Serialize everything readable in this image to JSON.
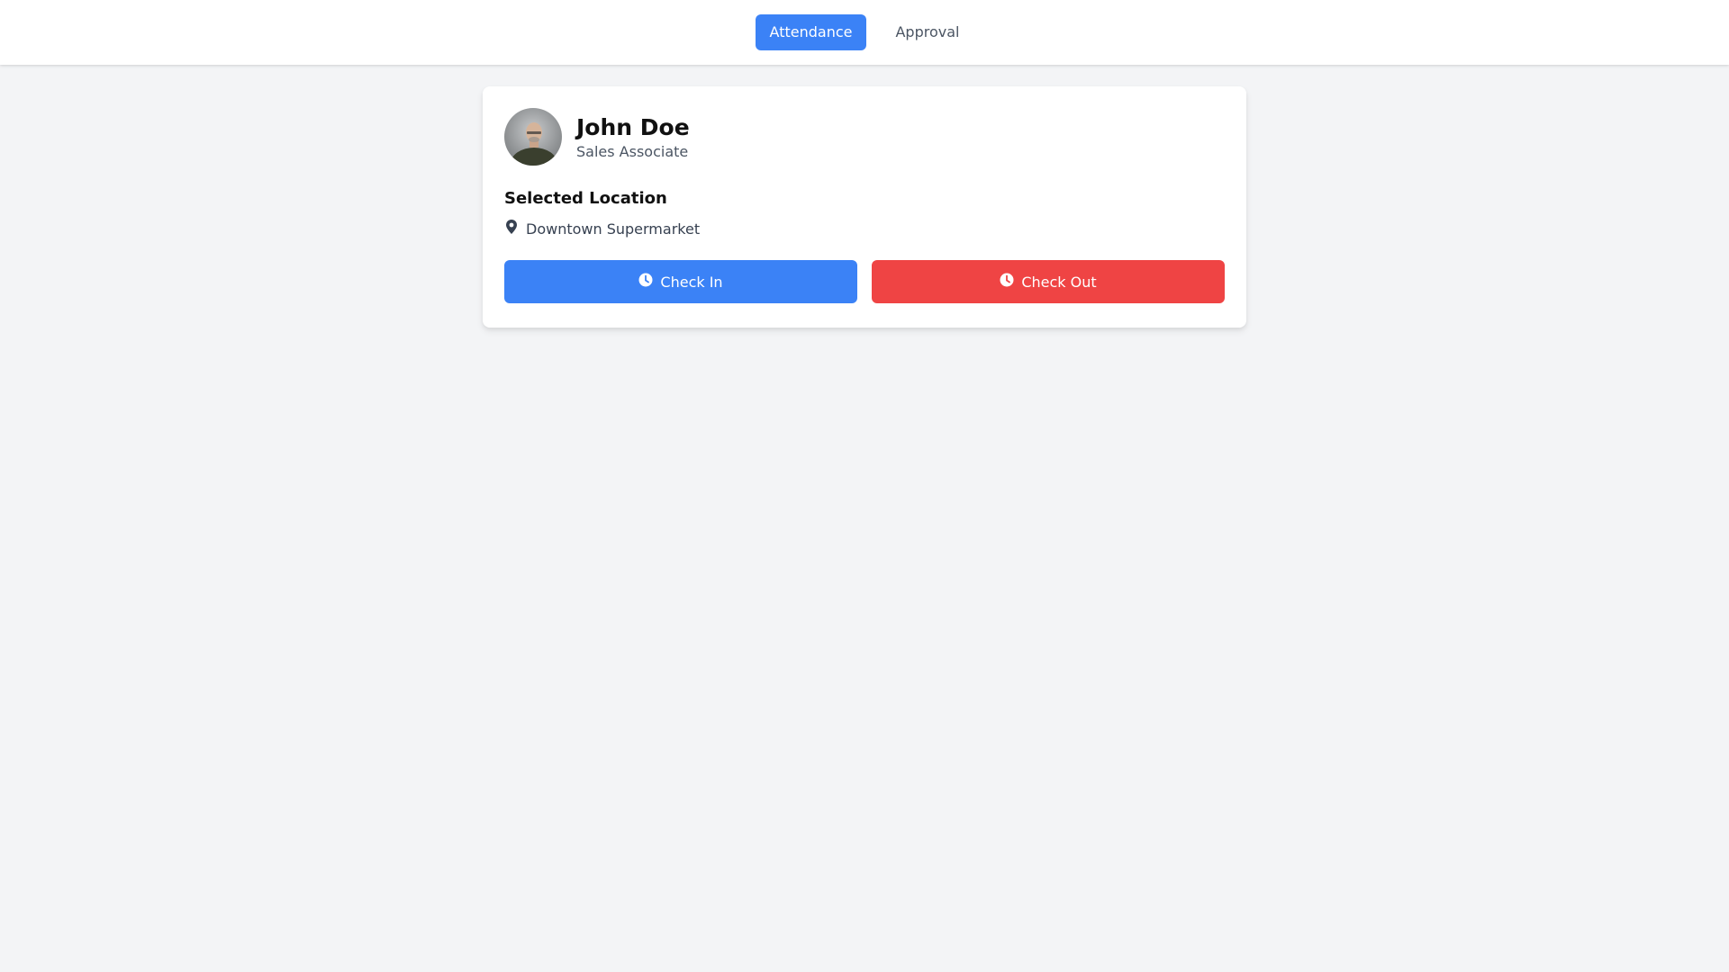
{
  "nav": {
    "tabs": [
      {
        "label": "Attendance",
        "active": true
      },
      {
        "label": "Approval",
        "active": false
      }
    ]
  },
  "profile": {
    "name": "John Doe",
    "role": "Sales Associate",
    "avatar_icon": "user-avatar-photo"
  },
  "location": {
    "heading": "Selected Location",
    "name": "Downtown Supermarket",
    "icon": "map-pin-icon"
  },
  "actions": {
    "check_in_label": "Check In",
    "check_out_label": "Check Out",
    "icon": "clock-icon"
  },
  "colors": {
    "primary": "#3b82f6",
    "danger": "#ef4444",
    "background": "#f3f4f6"
  }
}
